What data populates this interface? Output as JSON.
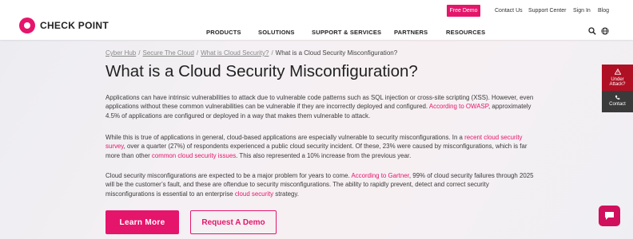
{
  "brand": {
    "name": "CHECK POINT",
    "accent": "#e5156c"
  },
  "topbar": {
    "free_demo": "Free Demo",
    "links": [
      "Contact Us",
      "Support Center",
      "Sign In",
      "Blog"
    ]
  },
  "nav": [
    "PRODUCTS",
    "SOLUTIONS",
    "SUPPORT & SERVICES",
    "PARTNERS",
    "RESOURCES"
  ],
  "icons": {
    "search": "search-icon",
    "language": "globe-icon"
  },
  "breadcrumb": {
    "items": [
      "Cyber Hub",
      "Secure The Cloud",
      "What is Cloud Security?"
    ],
    "current": "What is a Cloud Security Misconfiguration?",
    "separator": "/"
  },
  "page": {
    "title": "What is a Cloud Security Misconfiguration?"
  },
  "content": {
    "p1": {
      "text1": "Applications can have intrinsic vulnerabilities to attack due to vulnerable code patterns such as SQL injection or cross-site scripting (XSS). However, even applications without these common vulnerabilities can be vulnerable if they are incorrectly deployed and configured. ",
      "link1": "According to OWASP",
      "text2": ", approximately 4.5% of applications are configured or deployed in a way that makes them vulnerable to attack."
    },
    "p2": {
      "text1": "While this is true of applications in general, cloud-based applications are especially vulnerable to security misconfigurations. In a ",
      "link1": "recent cloud security survey",
      "text2": ", over a quarter (27%) of respondents experienced a public cloud security incident. Of these, 23% were caused by misconfigurations, which is far more than other ",
      "link2": "common cloud security issues",
      "text3": ". This also represented a 10% increase from the previous year."
    },
    "p3": {
      "text1": "Cloud security misconfigurations are expected to be a major problem for years to come. ",
      "link1": "According to Gartner",
      "text2": ", 99% of cloud security failures through 2025 will be the customer’s fault, and these are oftendue to security misconfigurations. The ability to rapidly prevent, detect and correct security misconfigurations is essential to an enterprise ",
      "link2": "cloud security",
      "text3": " strategy."
    }
  },
  "buttons": {
    "learn_more": "Learn More",
    "request_demo": "Request A Demo"
  },
  "side": {
    "attack": "Under Attack?",
    "contact": "Contact"
  }
}
